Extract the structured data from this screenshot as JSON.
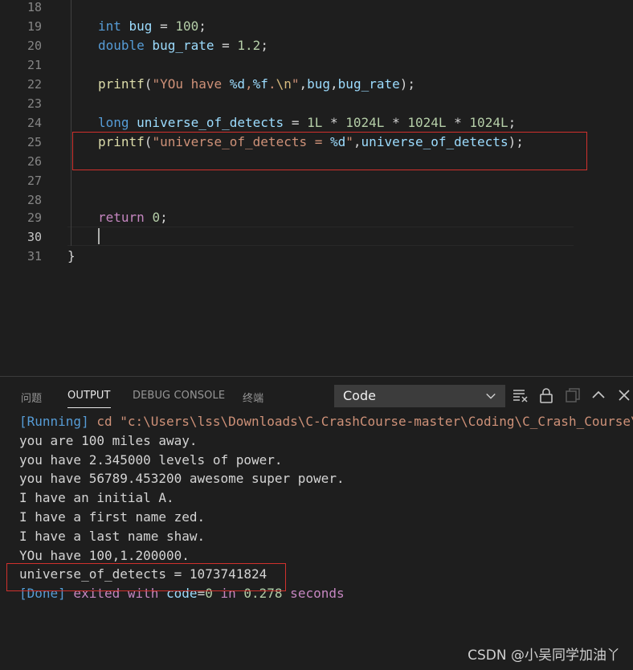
{
  "editor": {
    "lines": [
      {
        "n": "18"
      },
      {
        "n": "19",
        "t1": "int",
        "t2": " bug",
        "t3": " = ",
        "t4": "100",
        "t5": ";"
      },
      {
        "n": "20",
        "t1": "double",
        "t2": " bug_rate",
        "t3": " = ",
        "t4": "1.2",
        "t5": ";"
      },
      {
        "n": "21"
      },
      {
        "n": "22",
        "t1": "printf",
        "t2": "(",
        "t3": "\"YOu have ",
        "t4": "%d",
        "t5": ",",
        "t6": "%f",
        "t7": ".",
        "t8": "\\n",
        "t9": "\"",
        "t10": ",",
        "t11": "bug",
        "t12": ",",
        "t13": "bug_rate",
        "t14": ");"
      },
      {
        "n": "23"
      },
      {
        "n": "24",
        "t1": "long",
        "t2": " universe_of_detects",
        "t3": " = ",
        "t4": "1L",
        "t5": " * ",
        "t6": "1024L",
        "t7": " * ",
        "t8": "1024L",
        "t9": " * ",
        "t10": "1024L",
        "t11": ";"
      },
      {
        "n": "25",
        "t1": "printf",
        "t2": "(",
        "t3": "\"universe_of_detects = ",
        "t4": "%d",
        "t5": "\"",
        "t6": ",",
        "t7": "universe_of_detects",
        "t8": ");"
      },
      {
        "n": "26"
      },
      {
        "n": "27"
      },
      {
        "n": "28"
      },
      {
        "n": "29",
        "t1": "return",
        "t2": " ",
        "t3": "0",
        "t4": ";"
      },
      {
        "n": "30"
      },
      {
        "n": "31",
        "t1": "}"
      }
    ]
  },
  "panel": {
    "tabs": [
      "问题",
      "OUTPUT",
      "DEBUG CONSOLE",
      "终端"
    ],
    "active_tab": "OUTPUT",
    "channel_select": "Code",
    "output": {
      "run_tag": "[Running]",
      "run_cmd": " cd \"c:\\Users\\lss\\Downloads\\C-CrashCourse-master\\Coding\\C_Crash_Course\\",
      "lines": [
        "you are 100 miles away.",
        "you have 2.345000 levels of power.",
        "you have 56789.453200 awesome super power.",
        "I have an initial A.",
        "I have a first name zed.",
        "I have a last name shaw.",
        "YOu have 100,1.200000.",
        "universe_of_detects = 1073741824"
      ],
      "done_tag": "[Done]",
      "done_text1": " exited with ",
      "done_code_label": "code",
      "done_eq": "=",
      "done_code": "0",
      "done_text2": " in ",
      "done_time": "0.278",
      "done_text3": " seconds"
    }
  },
  "watermark": "CSDN @小吴同学加油丫",
  "colors": {
    "background": "#1e1e1e",
    "keyword": "#569cd6",
    "control": "#c586c0",
    "function": "#dcdcaa",
    "variable": "#9cdcfe",
    "number": "#b5cea8",
    "string": "#ce9178",
    "highlight_box": "#d0312d"
  }
}
